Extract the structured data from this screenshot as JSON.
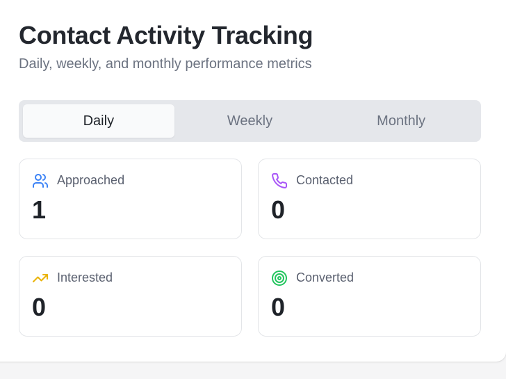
{
  "header": {
    "title": "Contact Activity Tracking",
    "subtitle": "Daily, weekly, and monthly performance metrics"
  },
  "tabs": [
    {
      "label": "Daily",
      "active": true
    },
    {
      "label": "Weekly",
      "active": false
    },
    {
      "label": "Monthly",
      "active": false
    }
  ],
  "metrics": [
    {
      "label": "Approached",
      "value": "1",
      "icon": "users-icon",
      "color": "#3b82f6"
    },
    {
      "label": "Contacted",
      "value": "0",
      "icon": "phone-icon",
      "color": "#a855f7"
    },
    {
      "label": "Interested",
      "value": "0",
      "icon": "trending-up-icon",
      "color": "#eab308"
    },
    {
      "label": "Converted",
      "value": "0",
      "icon": "target-icon",
      "color": "#22c55e"
    }
  ]
}
